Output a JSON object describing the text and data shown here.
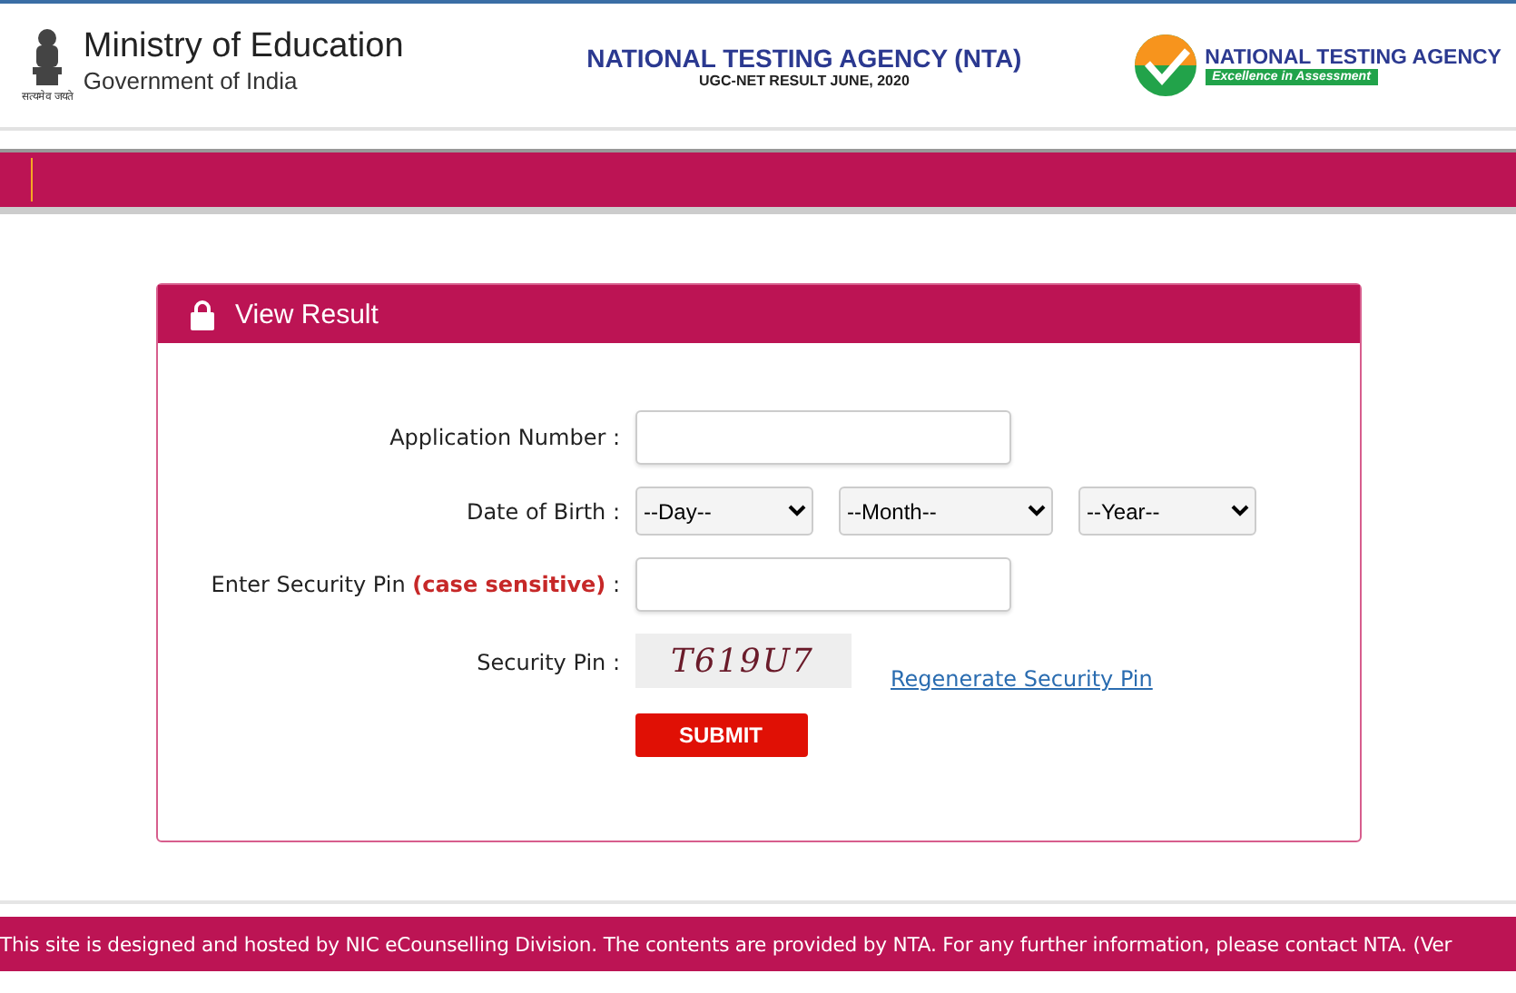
{
  "header": {
    "ministry": {
      "title": "Ministry of Education",
      "subtitle": "Government of India",
      "motto": "सत्यमेव जयते"
    },
    "center": {
      "title": "NATIONAL TESTING AGENCY (NTA)",
      "subtitle": "UGC-NET RESULT JUNE, 2020"
    },
    "logo": {
      "title": "NATIONAL TESTING AGENCY",
      "tagline": "Excellence in Assessment"
    }
  },
  "card": {
    "title": "View Result",
    "fields": [
      {
        "kind": "text",
        "label": "Application Number :"
      },
      {
        "kind": "selects",
        "label": "Date of Birth :",
        "options": [
          "--Day--",
          "--Month--",
          "--Year--"
        ]
      },
      {
        "kind": "text",
        "label": "Enter Security Pin **(case sensitive)** :"
      },
      {
        "kind": "captcha",
        "label": "Security Pin :",
        "code": "T619U7",
        "link": "Regenerate Security Pin"
      }
    ],
    "submit": "SUBMIT"
  },
  "footer": "This site is designed and hosted by NIC eCounselling Division. The contents are provided by NTA. For any further information, please contact NTA. (Ver"
}
